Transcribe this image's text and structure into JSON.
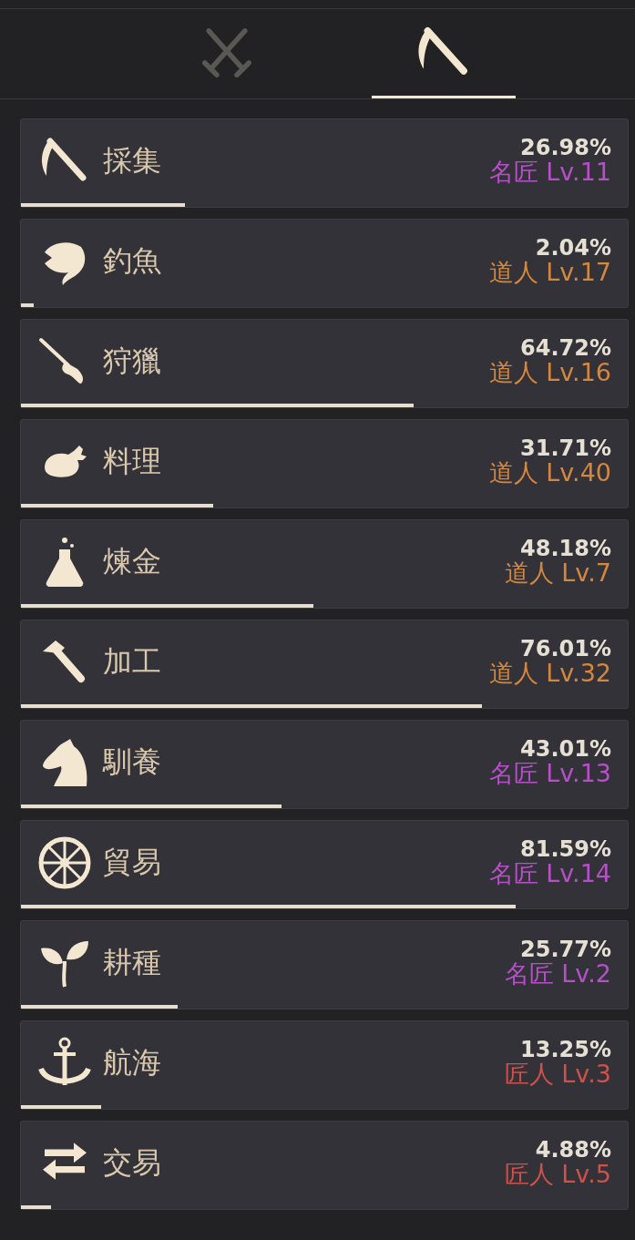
{
  "tabs": [
    {
      "selected": false
    },
    {
      "selected": true
    }
  ],
  "skills": [
    {
      "name": "採集",
      "percent": "26.98%",
      "rank": "名匠 Lv.11",
      "color": "#b64fc8",
      "level": 0.2698
    },
    {
      "name": "釣魚",
      "percent": "2.04%",
      "rank": "道人 Lv.17",
      "color": "#d4873f",
      "level": 0.0204
    },
    {
      "name": "狩獵",
      "percent": "64.72%",
      "rank": "道人 Lv.16",
      "color": "#d4873f",
      "level": 0.6472
    },
    {
      "name": "料理",
      "percent": "31.71%",
      "rank": "道人 Lv.40",
      "color": "#d4873f",
      "level": 0.3171
    },
    {
      "name": "煉金",
      "percent": "48.18%",
      "rank": "道人 Lv.7",
      "color": "#d4873f",
      "level": 0.4818
    },
    {
      "name": "加工",
      "percent": "76.01%",
      "rank": "道人 Lv.32",
      "color": "#d4873f",
      "level": 0.7601
    },
    {
      "name": "馴養",
      "percent": "43.01%",
      "rank": "名匠 Lv.13",
      "color": "#b64fc8",
      "level": 0.4301
    },
    {
      "name": "貿易",
      "percent": "81.59%",
      "rank": "名匠 Lv.14",
      "color": "#b64fc8",
      "level": 0.8159
    },
    {
      "name": "耕種",
      "percent": "25.77%",
      "rank": "名匠 Lv.2",
      "color": "#b64fc8",
      "level": 0.2577
    },
    {
      "name": "航海",
      "percent": "13.25%",
      "rank": "匠人 Lv.3",
      "color": "#d0504a",
      "level": 0.1325
    },
    {
      "name": "交易",
      "percent": "4.88%",
      "rank": "匠人 Lv.5",
      "color": "#d0504a",
      "level": 0.0488
    }
  ]
}
